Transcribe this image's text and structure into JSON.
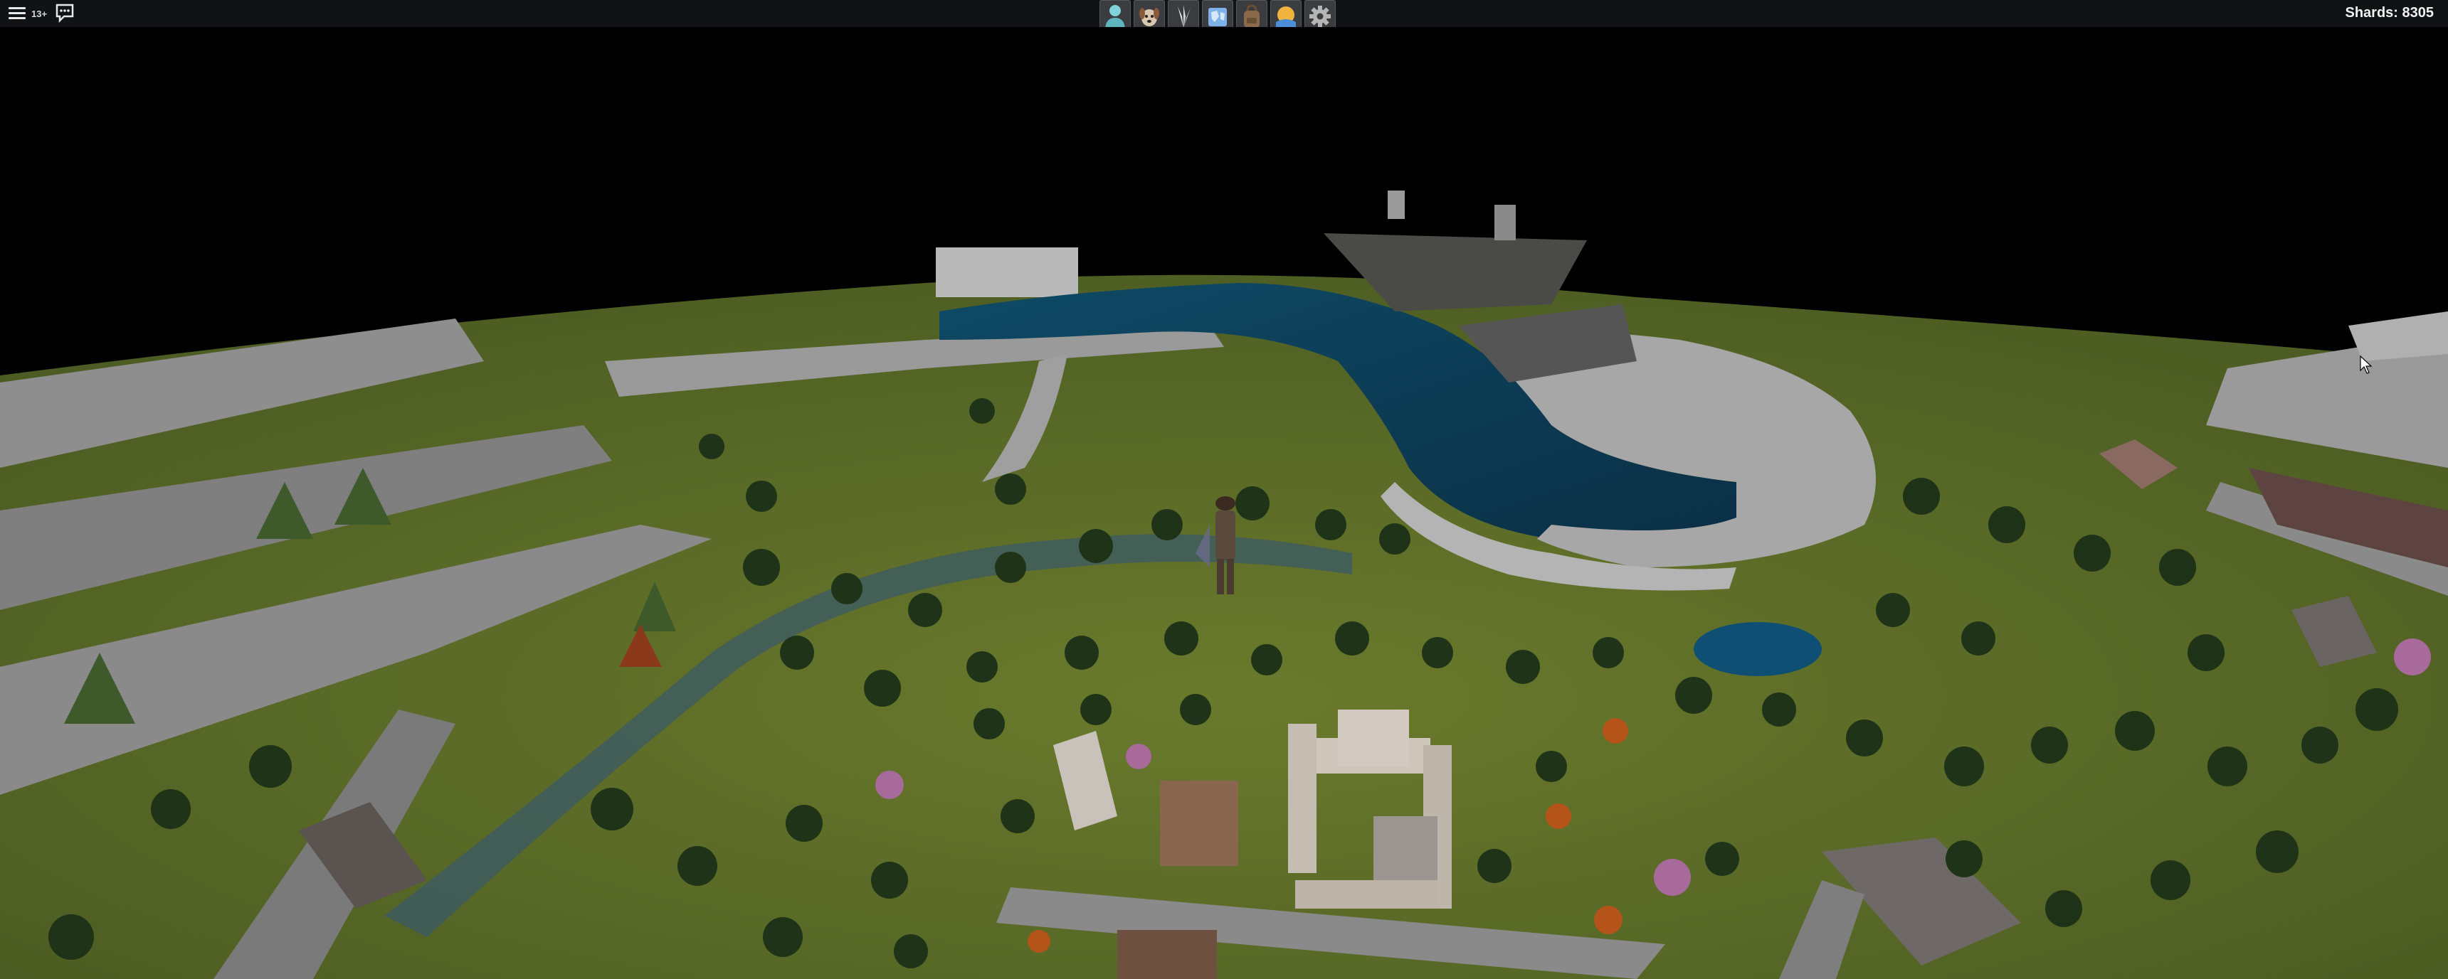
{
  "hud": {
    "age_rating": "13+",
    "shards_text": "Shards: 8305"
  },
  "toolbar": {
    "slots": [
      {
        "icon": "character-icon",
        "color": "#7fd3d9"
      },
      {
        "icon": "dog-pet-icon",
        "color": "#b88a66"
      },
      {
        "icon": "feather-wings-icon",
        "color": "#cfd6dc"
      },
      {
        "icon": "map-icon",
        "color": "#7fb2e8"
      },
      {
        "icon": "backpack-icon",
        "color": "#8a6a4a"
      },
      {
        "icon": "sun-weather-icon",
        "color": "#f0b43c"
      },
      {
        "icon": "gear-icon",
        "color": "#b5b5b5"
      }
    ]
  },
  "colors": {
    "sky": "#000000",
    "grass": "#5a6a28",
    "rock": "#9b9b9b",
    "water": "#0d3a52",
    "tree": "#1f3318"
  }
}
